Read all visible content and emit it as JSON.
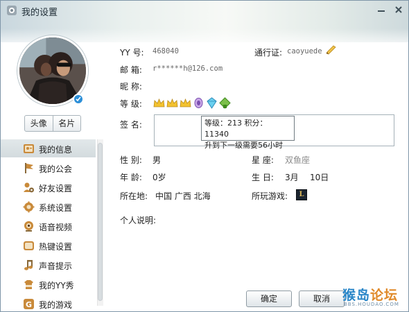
{
  "window": {
    "title": "我的设置"
  },
  "profile": {
    "avatar_btn": "头像",
    "card_btn": "名片"
  },
  "nav": {
    "items": [
      {
        "label": "我的信息",
        "icon": "id-card-icon",
        "active": true
      },
      {
        "label": "我的公会",
        "icon": "flag-icon"
      },
      {
        "label": "好友设置",
        "icon": "friend-settings-icon"
      },
      {
        "label": "系统设置",
        "icon": "gear-icon"
      },
      {
        "label": "语音视频",
        "icon": "webcam-icon"
      },
      {
        "label": "热键设置",
        "icon": "hotkey-icon"
      },
      {
        "label": "声音提示",
        "icon": "music-note-icon"
      },
      {
        "label": "我的YY秀",
        "icon": "yy-show-icon"
      },
      {
        "label": "我的游戏",
        "icon": "game-icon"
      }
    ]
  },
  "info": {
    "yy_label": "YY  号:",
    "yy_value": "468040",
    "pass_label": "通行证:",
    "pass_value": "caoyuede",
    "email_label": "邮  箱:",
    "email_value": "r******h@126.com",
    "nick_label": "昵  称:",
    "level_label": "等  级:",
    "sig_label": "签  名:",
    "tooltip_line1": "等级：213  积分：11340",
    "tooltip_line2": "升到下一级需要56小时",
    "gender_label": "性  别:",
    "gender_value": "男",
    "star_label": "星  座:",
    "star_value": "双鱼座",
    "age_label": "年  龄:",
    "age_value": "0岁",
    "bday_label": "生  日:",
    "bday_month": "3月",
    "bday_day": "10日",
    "loc_label": "所在地:",
    "loc_value": "中国  广西  北海",
    "games_label": "所玩游戏:",
    "game_icon_letter": "L",
    "desc_label": "个人说明:"
  },
  "buttons": {
    "ok": "确定",
    "cancel": "取消"
  },
  "watermark": {
    "main_a": "猴岛",
    "main_b": "论坛",
    "sub": "BBS.HOUDAO.COM"
  },
  "colors": {
    "accent": "#2a86c8",
    "nav_active": "#d9e0e3"
  }
}
